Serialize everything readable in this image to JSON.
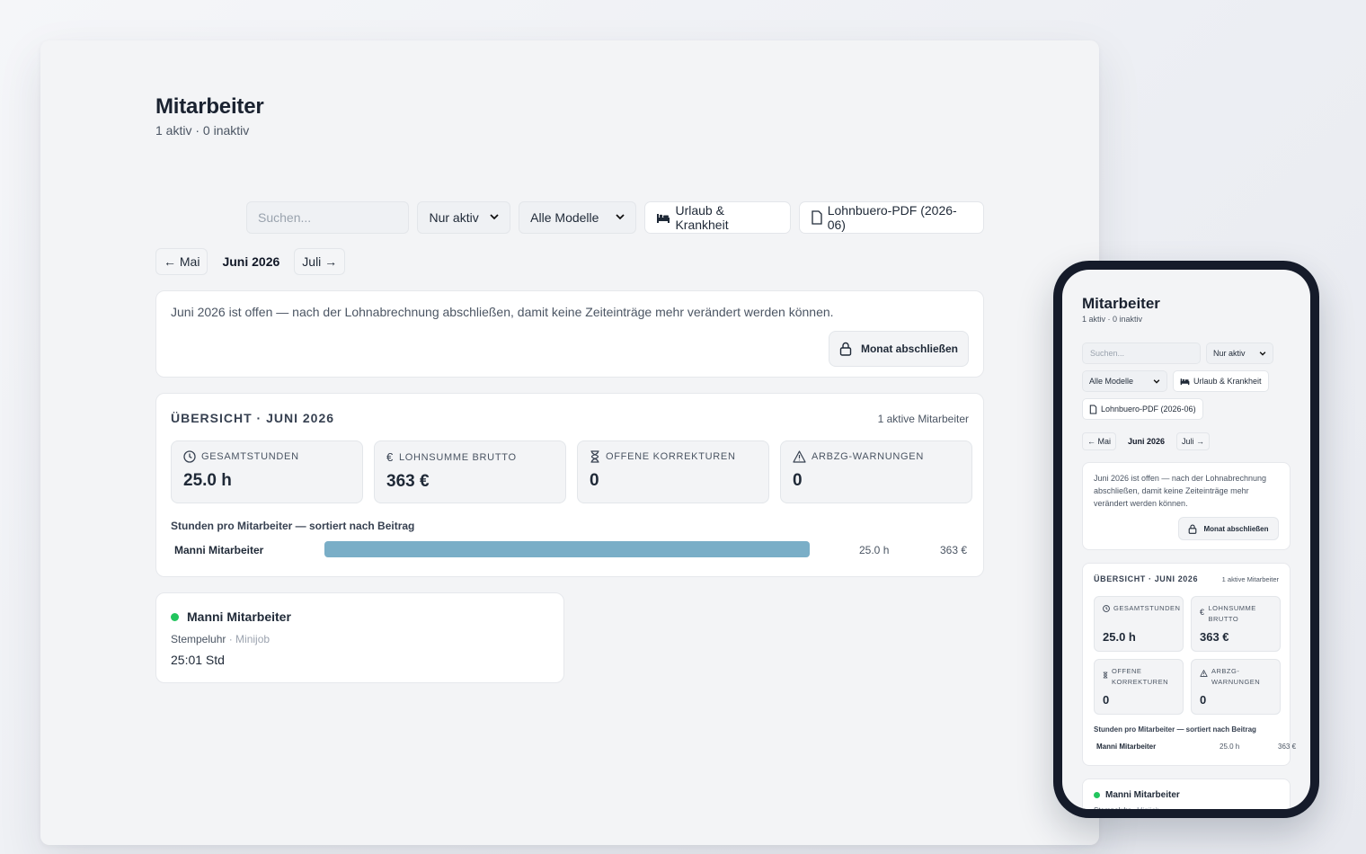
{
  "page": {
    "title": "Mitarbeiter",
    "subtitle": "1 aktiv · 0 inaktiv"
  },
  "toolbar": {
    "search_placeholder": "Suchen...",
    "status_filter": "Nur aktiv",
    "model_filter": "Alle Modelle",
    "leave_button": "Urlaub & Krankheit",
    "pdf_button": "Lohnbuero-PDF (2026-06)"
  },
  "month_nav": {
    "prev": "← Mai",
    "current": "Juni 2026",
    "next": "Juli →"
  },
  "lock": {
    "message": "Juni 2026 ist offen — nach der Lohnabrechnung abschließen, damit keine Zeiteinträge mehr verändert werden können.",
    "button": "Monat abschließen"
  },
  "overview": {
    "title": "ÜBERSICHT · JUNI 2026",
    "active_count": "1 aktive Mitarbeiter",
    "stats": [
      {
        "label": "GESAMTSTUNDEN",
        "value": "25.0 h",
        "icon": "clock-icon"
      },
      {
        "label": "LOHNSUMME BRUTTO",
        "value": "363 €",
        "icon": "euro-icon"
      },
      {
        "label": "OFFENE KORREKTUREN",
        "value": "0",
        "icon": "hourglass-icon"
      },
      {
        "label": "ARBZG-WARNUNGEN",
        "value": "0",
        "icon": "warning-icon"
      }
    ],
    "bar_caption": "Stunden pro Mitarbeiter — sortiert nach Beitrag",
    "bars": [
      {
        "name": "Manni Mitarbeiter",
        "hours": "25.0 h",
        "sum": "363 €",
        "fraction": 1.0
      }
    ],
    "bar_color": "#7aaec7"
  },
  "employees": [
    {
      "name": "Manni Mitarbeiter",
      "mode": "Stempeluhr",
      "model": "Minijob",
      "time": "25:01 Std",
      "status_color": "#22c55e"
    }
  ],
  "phone": {
    "stats": [
      {
        "label": "GESAMTSTUNDEN",
        "value": "25.0 h"
      },
      {
        "label": "LOHNSUMME BRUTTO",
        "value": "363 €"
      },
      {
        "label": "OFFENE KORREKTUREN",
        "value": "0"
      },
      {
        "label": "ARBZG-WARNUNGEN",
        "value": "0"
      }
    ],
    "bar_sum": "363 €"
  }
}
